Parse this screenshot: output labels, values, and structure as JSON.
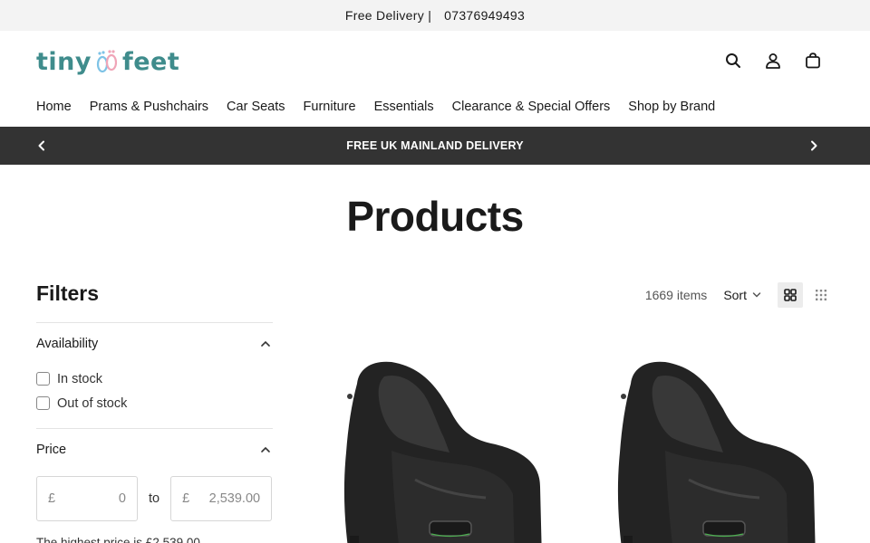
{
  "announcement": {
    "text": "Free Delivery |",
    "phone": "07376949493"
  },
  "brand": {
    "part1": "tiny",
    "part2": "feet"
  },
  "header_icons": [
    "search-icon",
    "account-icon",
    "cart-icon"
  ],
  "nav": [
    {
      "label": "Home"
    },
    {
      "label": "Prams & Pushchairs"
    },
    {
      "label": "Car Seats"
    },
    {
      "label": "Furniture"
    },
    {
      "label": "Essentials"
    },
    {
      "label": "Clearance & Special Offers"
    },
    {
      "label": "Shop by Brand"
    }
  ],
  "promo": {
    "text": "FREE UK MAINLAND DELIVERY"
  },
  "page": {
    "title": "Products"
  },
  "filters": {
    "title": "Filters",
    "availability": {
      "label": "Availability",
      "options": [
        "In stock",
        "Out of stock"
      ]
    },
    "price": {
      "label": "Price",
      "currency": "£",
      "min_placeholder": "0",
      "max_placeholder": "2,539.00",
      "to_label": "to",
      "note": "The highest price is £2,539.00"
    }
  },
  "toolbar": {
    "count": "1669 items",
    "sort_label": "Sort"
  },
  "colors": {
    "brand_teal": "#3f8c8c",
    "brand_blue": "#7ec3e6",
    "promo_bar": "#333333"
  }
}
